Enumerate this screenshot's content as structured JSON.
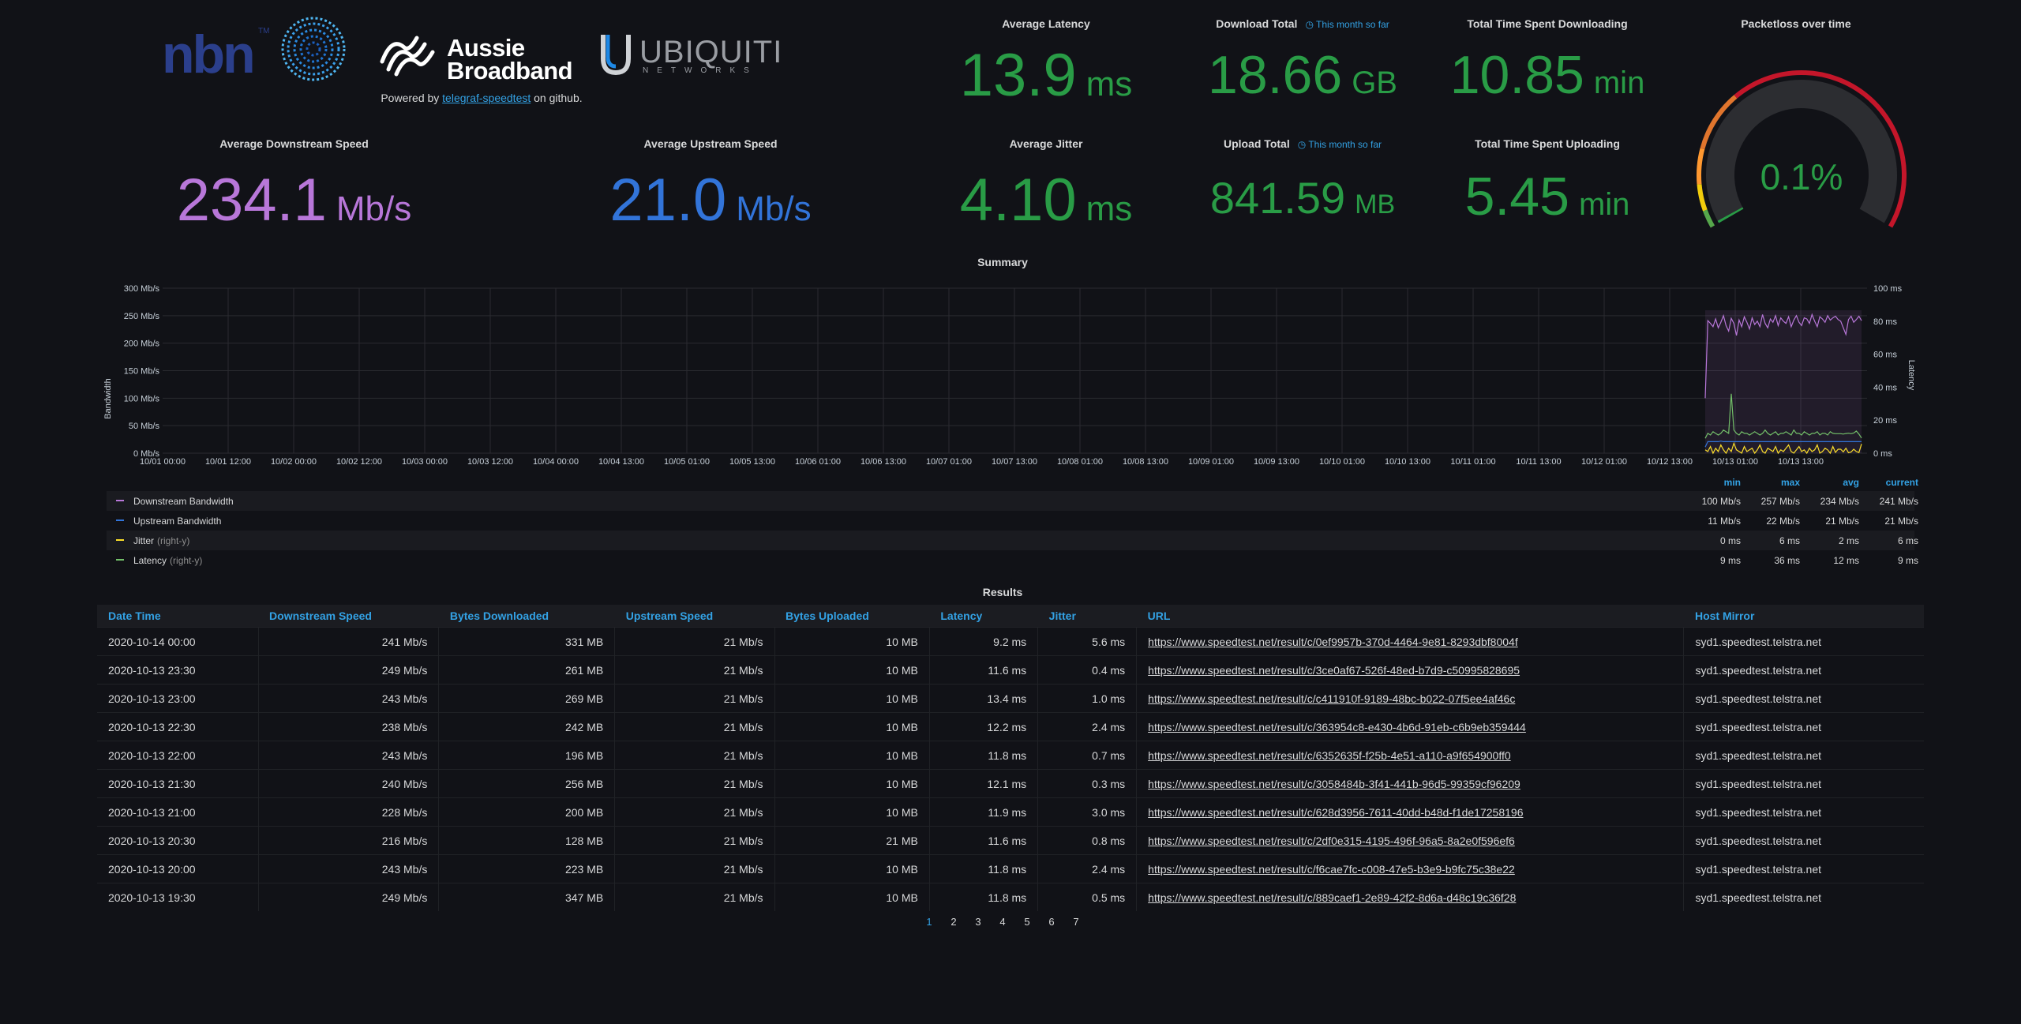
{
  "logos": {
    "nbn": {
      "text": "nbn",
      "tm": "TM"
    },
    "aussie": {
      "line1": "Aussie",
      "line2": "Broadband"
    },
    "ubiquiti": {
      "text": "UBIQUITI",
      "sub": "NETWORKS"
    }
  },
  "powered": {
    "prefix": "Powered by ",
    "link": "telegraf-speedtest",
    "suffix": " on github."
  },
  "stats": {
    "avg_latency": {
      "title": "Average Latency",
      "value": "13.9",
      "unit": "ms"
    },
    "download_total": {
      "title": "Download Total",
      "info": "This month so far",
      "value": "18.66",
      "unit": "GB"
    },
    "time_downloading": {
      "title": "Total Time Spent Downloading",
      "value": "10.85",
      "unit": "min"
    },
    "packetloss": {
      "title": "Packetloss over time",
      "value": "0.1%",
      "level": 0.001
    },
    "avg_downstream": {
      "title": "Average Downstream Speed",
      "value": "234.1",
      "unit": "Mb/s"
    },
    "avg_upstream": {
      "title": "Average Upstream Speed",
      "value": "21.0",
      "unit": "Mb/s"
    },
    "avg_jitter": {
      "title": "Average Jitter",
      "value": "4.10",
      "unit": "ms"
    },
    "upload_total": {
      "title": "Upload Total",
      "info": "This month so far",
      "value": "841.59",
      "unit": "MB"
    },
    "time_uploading": {
      "title": "Total Time Spent Uploading",
      "value": "5.45",
      "unit": "min"
    }
  },
  "colors": {
    "green": "#299c46",
    "purple": "#b877d9",
    "blue": "#3274d9",
    "yellow": "#fade2a",
    "link": "#33a2e5"
  },
  "chart_data": {
    "type": "line",
    "title": "Summary",
    "ylabel": "Bandwidth",
    "y2label": "Latency",
    "ylim": [
      0,
      300
    ],
    "y2lim": [
      0,
      100
    ],
    "yticks": [
      "0 Mb/s",
      "50 Mb/s",
      "100 Mb/s",
      "150 Mb/s",
      "200 Mb/s",
      "250 Mb/s",
      "300 Mb/s"
    ],
    "y2ticks": [
      "0 ms",
      "20 ms",
      "40 ms",
      "60 ms",
      "80 ms",
      "100 ms"
    ],
    "xticks": [
      "10/01 00:00",
      "10/01 12:00",
      "10/02 00:00",
      "10/02 12:00",
      "10/03 00:00",
      "10/03 12:00",
      "10/04 00:00",
      "10/04 13:00",
      "10/05 01:00",
      "10/05 13:00",
      "10/06 01:00",
      "10/06 13:00",
      "10/07 01:00",
      "10/07 13:00",
      "10/08 01:00",
      "10/08 13:00",
      "10/09 01:00",
      "10/09 13:00",
      "10/10 01:00",
      "10/10 13:00",
      "10/11 01:00",
      "10/11 13:00",
      "10/12 01:00",
      "10/12 13:00",
      "10/13 01:00",
      "10/13 13:00"
    ],
    "grid": true,
    "series": [
      {
        "name": "Downstream Bandwidth",
        "color": "#b877d9",
        "axis": "left",
        "values": [
          100,
          241,
          236,
          230,
          244,
          228,
          238,
          250,
          232,
          222,
          245,
          236,
          214,
          242,
          230,
          248,
          238,
          226,
          246,
          234,
          240,
          230,
          252,
          236,
          228,
          244,
          238,
          250,
          232,
          246,
          240,
          236,
          248,
          230,
          242,
          250,
          238,
          232,
          246,
          244,
          236,
          252,
          240,
          230,
          248,
          244,
          238,
          250,
          242,
          246,
          249,
          243,
          240,
          228,
          216,
          243,
          249,
          238,
          243,
          249,
          241
        ]
      },
      {
        "name": "Upstream Bandwidth",
        "color": "#3274d9",
        "axis": "left",
        "values": [
          11,
          21,
          21,
          21,
          21,
          21,
          22,
          21,
          21,
          21,
          21,
          21,
          21,
          21,
          21,
          21,
          21,
          21,
          21,
          21,
          21,
          21,
          21,
          21,
          21,
          21,
          21,
          21,
          21,
          21,
          21,
          21,
          21,
          21,
          21,
          21,
          21,
          21,
          21,
          21,
          21,
          21,
          21,
          21,
          21,
          21,
          21,
          21,
          21,
          21,
          21,
          21,
          21,
          21,
          21,
          21,
          21,
          21,
          21,
          21,
          21
        ]
      },
      {
        "name": "Jitter",
        "axis_label": "(right-y)",
        "color": "#fade2a",
        "axis": "right",
        "values": [
          2,
          1,
          4,
          0,
          3,
          1,
          5,
          2,
          0,
          3,
          1,
          6,
          2,
          1,
          0,
          4,
          1,
          2,
          3,
          0,
          2,
          5,
          1,
          0,
          3,
          2,
          1,
          4,
          0,
          2,
          1,
          3,
          5,
          1,
          0,
          2,
          4,
          1,
          2,
          0,
          3,
          1,
          2,
          5,
          0,
          1,
          3,
          2,
          0,
          4,
          0.5,
          2.4,
          2.4,
          0.8,
          3.0,
          0.3,
          0.7,
          2.4,
          1.0,
          0.4,
          5.6
        ]
      },
      {
        "name": "Latency",
        "axis_label": "(right-y)",
        "color": "#73bf69",
        "axis": "right",
        "values": [
          9,
          12,
          11,
          13,
          12,
          11,
          12,
          14,
          13,
          12,
          36,
          14,
          12,
          11,
          13,
          12,
          12,
          11,
          12,
          13,
          12,
          11,
          12,
          14,
          12,
          11,
          12,
          13,
          11,
          12,
          12,
          13,
          12,
          11,
          14,
          12,
          12,
          11,
          13,
          12,
          11,
          12,
          12,
          13,
          11,
          12,
          12,
          11,
          13,
          12,
          11.8,
          11.8,
          11.8,
          11.6,
          11.9,
          12.1,
          11.8,
          12.2,
          13.4,
          11.6,
          9.2
        ]
      }
    ]
  },
  "legend": {
    "headers": [
      "min",
      "max",
      "avg",
      "current"
    ],
    "rows": [
      {
        "name": "Downstream Bandwidth",
        "axis": "",
        "color": "#b877d9",
        "min": "100 Mb/s",
        "max": "257 Mb/s",
        "avg": "234 Mb/s",
        "current": "241 Mb/s"
      },
      {
        "name": "Upstream Bandwidth",
        "axis": "",
        "color": "#3274d9",
        "min": "11 Mb/s",
        "max": "22 Mb/s",
        "avg": "21 Mb/s",
        "current": "21 Mb/s"
      },
      {
        "name": "Jitter",
        "axis": "(right-y)",
        "color": "#fade2a",
        "min": "0 ms",
        "max": "6 ms",
        "avg": "2 ms",
        "current": "6 ms"
      },
      {
        "name": "Latency",
        "axis": "(right-y)",
        "color": "#73bf69",
        "min": "9 ms",
        "max": "36 ms",
        "avg": "12 ms",
        "current": "9 ms"
      }
    ]
  },
  "results": {
    "title": "Results",
    "columns": [
      "Date Time",
      "Downstream Speed",
      "Bytes Downloaded",
      "Upstream Speed",
      "Bytes Uploaded",
      "Latency",
      "Jitter",
      "URL",
      "Host Mirror"
    ],
    "rows": [
      [
        "2020-10-14 00:00",
        "241 Mb/s",
        "331 MB",
        "21 Mb/s",
        "10 MB",
        "9.2 ms",
        "5.6 ms",
        "https://www.speedtest.net/result/c/0ef9957b-370d-4464-9e81-8293dbf8004f",
        "syd1.speedtest.telstra.net"
      ],
      [
        "2020-10-13 23:30",
        "249 Mb/s",
        "261 MB",
        "21 Mb/s",
        "10 MB",
        "11.6 ms",
        "0.4 ms",
        "https://www.speedtest.net/result/c/3ce0af67-526f-48ed-b7d9-c50995828695",
        "syd1.speedtest.telstra.net"
      ],
      [
        "2020-10-13 23:00",
        "243 Mb/s",
        "269 MB",
        "21 Mb/s",
        "10 MB",
        "13.4 ms",
        "1.0 ms",
        "https://www.speedtest.net/result/c/c411910f-9189-48bc-b022-07f5ee4af46c",
        "syd1.speedtest.telstra.net"
      ],
      [
        "2020-10-13 22:30",
        "238 Mb/s",
        "242 MB",
        "21 Mb/s",
        "10 MB",
        "12.2 ms",
        "2.4 ms",
        "https://www.speedtest.net/result/c/363954c8-e430-4b6d-91eb-c6b9eb359444",
        "syd1.speedtest.telstra.net"
      ],
      [
        "2020-10-13 22:00",
        "243 Mb/s",
        "196 MB",
        "21 Mb/s",
        "10 MB",
        "11.8 ms",
        "0.7 ms",
        "https://www.speedtest.net/result/c/6352635f-f25b-4e51-a110-a9f654900ff0",
        "syd1.speedtest.telstra.net"
      ],
      [
        "2020-10-13 21:30",
        "240 Mb/s",
        "256 MB",
        "21 Mb/s",
        "10 MB",
        "12.1 ms",
        "0.3 ms",
        "https://www.speedtest.net/result/c/3058484b-3f41-441b-96d5-99359cf96209",
        "syd1.speedtest.telstra.net"
      ],
      [
        "2020-10-13 21:00",
        "228 Mb/s",
        "200 MB",
        "21 Mb/s",
        "10 MB",
        "11.9 ms",
        "3.0 ms",
        "https://www.speedtest.net/result/c/628d3956-7611-40dd-b48d-f1de17258196",
        "syd1.speedtest.telstra.net"
      ],
      [
        "2020-10-13 20:30",
        "216 Mb/s",
        "128 MB",
        "21 Mb/s",
        "21 MB",
        "11.6 ms",
        "0.8 ms",
        "https://www.speedtest.net/result/c/2df0e315-4195-496f-96a5-8a2e0f596ef6",
        "syd1.speedtest.telstra.net"
      ],
      [
        "2020-10-13 20:00",
        "243 Mb/s",
        "223 MB",
        "21 Mb/s",
        "10 MB",
        "11.8 ms",
        "2.4 ms",
        "https://www.speedtest.net/result/c/f6cae7fc-c008-47e5-b3e9-b9fc75c38e22",
        "syd1.speedtest.telstra.net"
      ],
      [
        "2020-10-13 19:30",
        "249 Mb/s",
        "347 MB",
        "21 Mb/s",
        "10 MB",
        "11.8 ms",
        "0.5 ms",
        "https://www.speedtest.net/result/c/889caef1-2e89-42f2-8d6a-d48c19c36f28",
        "syd1.speedtest.telstra.net"
      ]
    ]
  },
  "pagination": {
    "pages": [
      "1",
      "2",
      "3",
      "4",
      "5",
      "6",
      "7"
    ],
    "active": "1"
  }
}
